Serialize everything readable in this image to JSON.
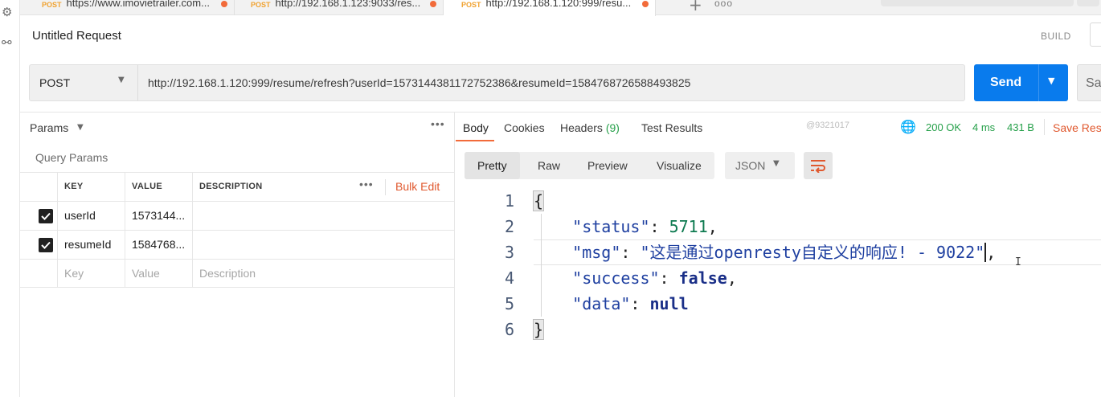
{
  "tabs": [
    {
      "method": "POST",
      "url": "https://www.imovietrailer.com..."
    },
    {
      "method": "POST",
      "url": "http://192.168.1.123:9033/res..."
    },
    {
      "method": "POST",
      "url": "http://192.168.1.120:999/resu..."
    }
  ],
  "tab_actions": {
    "add": "+",
    "more": "ooo"
  },
  "request": {
    "title": "Untitled Request",
    "build_label": "BUILD",
    "method": "POST",
    "url": "http://192.168.1.120:999/resume/refresh?userId=1573144381172752386&resumeId=1584768726588493825",
    "send_label": "Send",
    "save_label": "Save"
  },
  "params": {
    "label": "Params",
    "query_label": "Query Params",
    "columns": [
      "KEY",
      "VALUE",
      "DESCRIPTION"
    ],
    "bulk_edit": "Bulk Edit",
    "rows": [
      {
        "key": "userId",
        "value": "1573144...",
        "checked": true
      },
      {
        "key": "resumeId",
        "value": "1584768...",
        "checked": true
      }
    ],
    "placeholder_row": {
      "key": "Key",
      "value": "Value",
      "description": "Description"
    }
  },
  "response": {
    "tabs": {
      "body": "Body",
      "cookies": "Cookies",
      "headers": "Headers",
      "headers_count": "(9)",
      "test_results": "Test Results"
    },
    "watermark": "@9321017",
    "status": "200 OK",
    "time": "4 ms",
    "size": "431 B",
    "save_response": "Save Response",
    "view_tabs": [
      "Pretty",
      "Raw",
      "Preview",
      "Visualize"
    ],
    "format": "JSON",
    "code": {
      "line_numbers": [
        "1",
        "2",
        "3",
        "4",
        "5",
        "6"
      ],
      "open_brace": "{",
      "close_brace": "}",
      "key_status": "\"status\"",
      "val_status": "5711",
      "key_msg": "\"msg\"",
      "val_msg": "\"这是通过openresty自定义的响应! - 9022\"",
      "key_success": "\"success\"",
      "val_success": "false",
      "key_data": "\"data\"",
      "val_data": "null"
    }
  },
  "colors": {
    "accent": "#f26b3a",
    "send": "#097bed",
    "status_ok": "#26a04a",
    "method": "#f0a230"
  },
  "icons": [
    "settings-icon",
    "share-icon",
    "checkbox-checked-icon",
    "globe-icon",
    "wrap-lines-icon",
    "chevron-down-icon"
  ]
}
